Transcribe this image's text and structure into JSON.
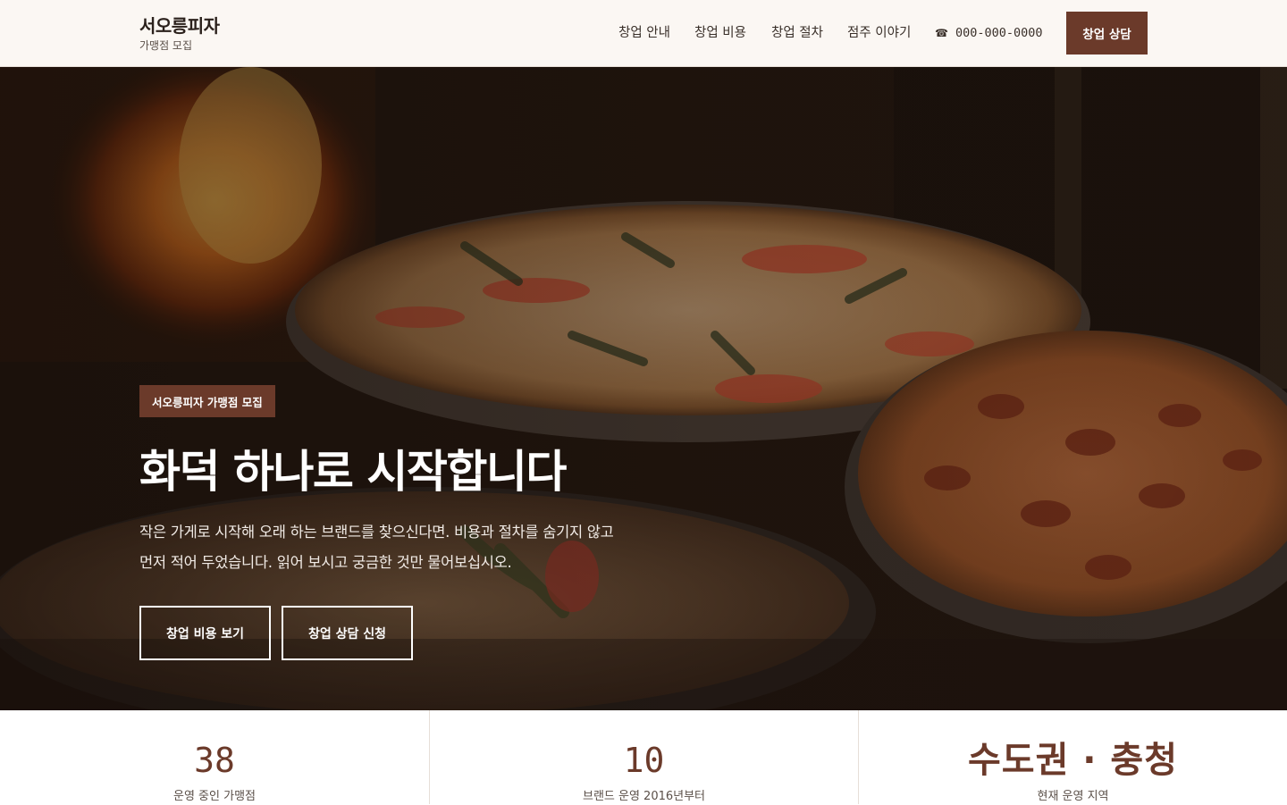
{
  "header": {
    "brand_name": "서오릉피자",
    "brand_sub": "가맹점 모집",
    "nav": [
      "창업 안내",
      "창업 비용",
      "창업 절차",
      "점주 이야기"
    ],
    "phone_icon": "phone-icon",
    "phone": "000-000-0000",
    "cta": "창업 상담"
  },
  "hero": {
    "badge": "서오릉피자 가맹점 모집",
    "title": "화덕 하나로 시작합니다",
    "desc_line1": "작은 가게로 시작해 오래 하는 브랜드를 찾으신다면. 비용과 절차를 숨기지 않고",
    "desc_line2": "먼저 적어 두었습니다. 읽어 보시고 궁금한 것만 물어보십시오.",
    "buttons": [
      "창업 비용 보기",
      "창업 상담 신청"
    ]
  },
  "stats": [
    {
      "value": "38",
      "label": "운영 중인 가맹점"
    },
    {
      "value": "10",
      "label": "브랜드 운영 2016년부터"
    },
    {
      "value": "수도권 · 충청",
      "label": "현재 운영 지역"
    }
  ],
  "colors": {
    "accent": "#6b3a2a",
    "header_bg": "#fbf7f3",
    "text_dark": "#2b211c"
  }
}
